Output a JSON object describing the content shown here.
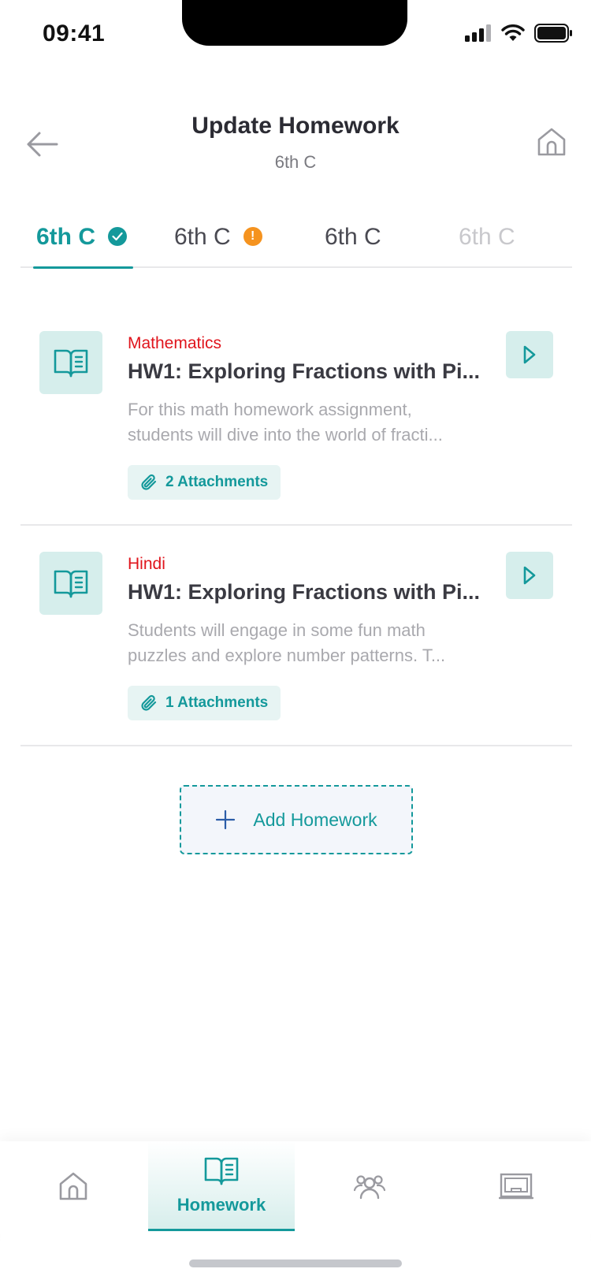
{
  "status_bar": {
    "time": "09:41"
  },
  "header": {
    "title": "Update Homework",
    "subtitle": "6th C"
  },
  "tabs": [
    {
      "label": "6th C",
      "state": "active",
      "badge": "check"
    },
    {
      "label": "6th C",
      "state": "default",
      "badge": "!"
    },
    {
      "label": "6th C",
      "state": "default"
    },
    {
      "label": "6th C",
      "state": "faded"
    }
  ],
  "homework": [
    {
      "subject": "Mathematics",
      "title": "HW1: Exploring Fractions with Pi...",
      "description_line1": "For this math homework assignment,",
      "description_line2": "students will dive into the world of fracti...",
      "attachments": "2 Attachments"
    },
    {
      "subject": "Hindi",
      "title": "HW1: Exploring Fractions with Pi...",
      "description_line1": "Students will engage in some fun math",
      "description_line2": "puzzles and explore number patterns. T...",
      "attachments": "1 Attachments"
    }
  ],
  "add_button": {
    "label": "Add Homework"
  },
  "bottom_nav": {
    "items": [
      {
        "icon": "home-icon"
      },
      {
        "icon": "book-icon",
        "label": "Homework",
        "active": true
      },
      {
        "icon": "people-icon"
      },
      {
        "icon": "board-icon"
      }
    ]
  },
  "colors": {
    "accent": "#14999b",
    "subject": "#e0141c",
    "warning": "#f5931f",
    "icon_bg": "#d6eeec"
  }
}
